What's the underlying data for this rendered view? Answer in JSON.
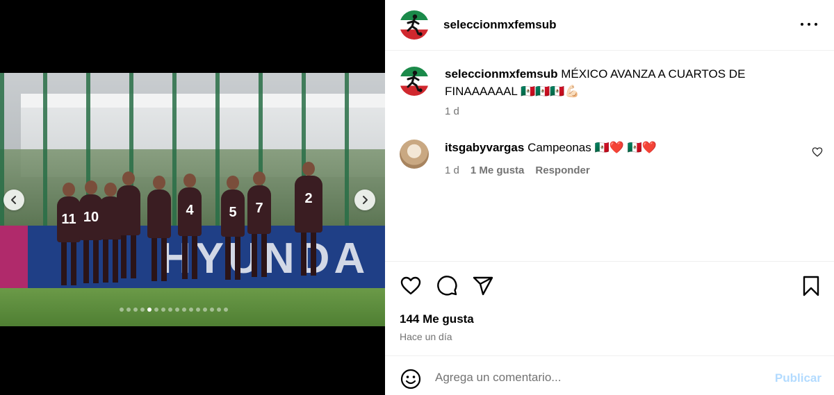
{
  "post": {
    "username": "seleccionmxfemsub",
    "caption_text": "MÉXICO AVANZA A CUARTOS DE FINAAAAAAL",
    "caption_emoji": "🇲🇽🇲🇽🇲🇽💪🏻",
    "caption_time": "1 d"
  },
  "media": {
    "board_text": "HYUNDA",
    "jersey_numbers": [
      "11",
      "10",
      "",
      "",
      "",
      "4",
      "5",
      "7",
      "2"
    ],
    "carousel": {
      "total": 16,
      "active_index": 4
    }
  },
  "comments": [
    {
      "username": "itsgabyvargas",
      "text": "Campeonas",
      "flag1": "🇲🇽",
      "heart1": "❤️",
      "flag2": "🇲🇽",
      "heart2": "❤️",
      "time": "1 d",
      "likes": "1 Me gusta",
      "reply": "Responder"
    }
  ],
  "stats": {
    "likes": "144 Me gusta",
    "time_ago": "Hace un día"
  },
  "comment_bar": {
    "placeholder": "Agrega un comentario...",
    "publish": "Publicar"
  },
  "icons": {
    "more": "more-options-icon",
    "like": "heart-icon",
    "comment": "comment-icon",
    "share": "share-icon",
    "save": "bookmark-icon",
    "emoji": "emoji-icon",
    "prev": "chevron-left-icon",
    "next": "chevron-right-icon"
  },
  "colors": {
    "publish_disabled": "#b3dbff",
    "secondary_text": "#737373",
    "divider": "#efefef"
  }
}
